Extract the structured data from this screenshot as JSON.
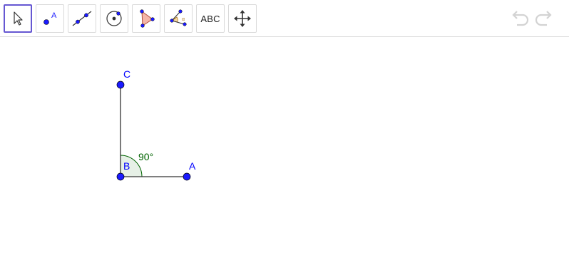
{
  "toolbar": {
    "tools": [
      {
        "name": "move-tool",
        "icon": "cursor-arrow-icon",
        "selected": true
      },
      {
        "name": "point-tool",
        "icon": "point-icon",
        "label": "A"
      },
      {
        "name": "line-tool",
        "icon": "line-through-points-icon"
      },
      {
        "name": "circle-tool",
        "icon": "circle-with-center-icon"
      },
      {
        "name": "polygon-tool",
        "icon": "polygon-icon"
      },
      {
        "name": "angle-tool",
        "icon": "angle-icon",
        "label": "α"
      },
      {
        "name": "text-tool",
        "icon": "text-icon",
        "label": "ABC"
      },
      {
        "name": "move-graphics-view-tool",
        "icon": "move-arrows-icon"
      }
    ],
    "undo_icon": "undo-icon",
    "redo_icon": "redo-icon"
  },
  "construction": {
    "points": [
      {
        "label": "C"
      },
      {
        "label": "B"
      },
      {
        "label": "A"
      }
    ],
    "angle_label": "90°",
    "colors": {
      "point": "#1a1aff",
      "point_label": "#0000ff",
      "segment": "#333333",
      "angle_fill": "#e6f0e6",
      "angle_stroke": "#006400",
      "angle_label": "#006400",
      "toolbar_selected": "#6557d2"
    }
  }
}
